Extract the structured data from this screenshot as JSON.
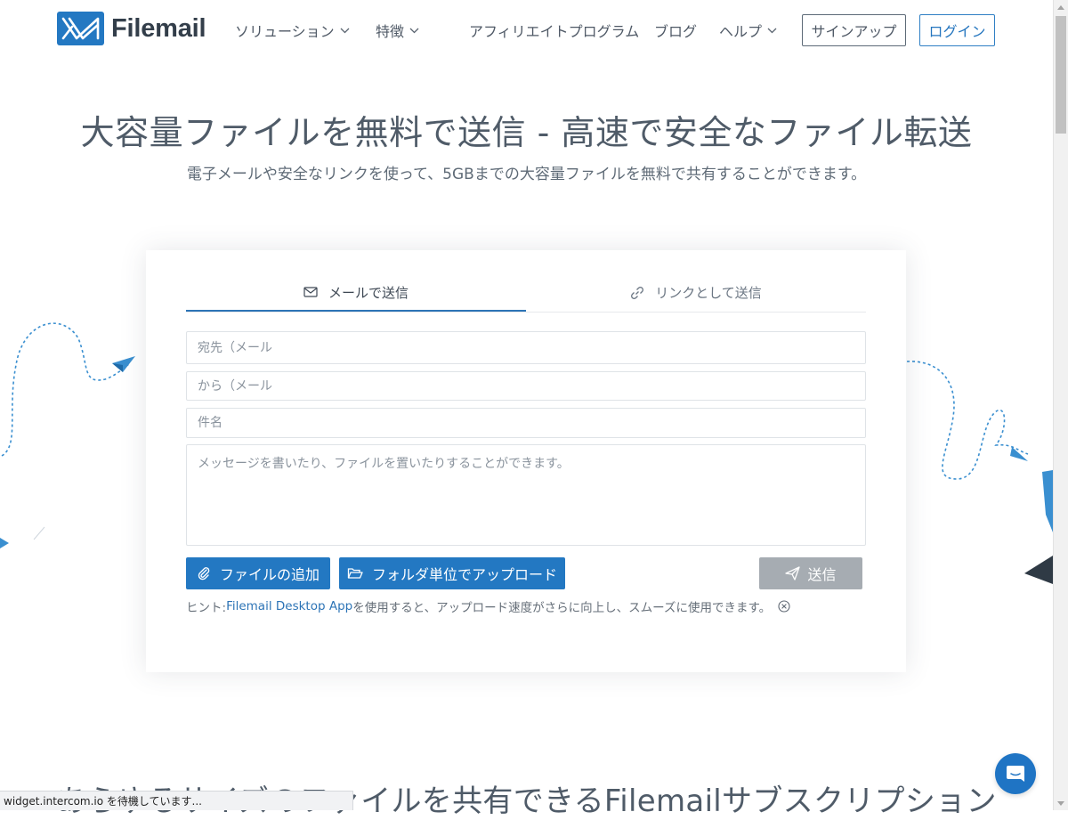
{
  "brand": {
    "name": "Filemail",
    "color": "#2378c2"
  },
  "nav": {
    "solutions": "ソリューション",
    "features": "特徴",
    "affiliate": "アフィリエイトプログラム",
    "blog": "ブログ",
    "help": "ヘルプ",
    "signup": "サインアップ",
    "login": "ログイン"
  },
  "hero": {
    "title": "大容量ファイルを無料で送信 - 高速で安全なファイル転送",
    "subtitle": "電子メールや安全なリンクを使って、5GBまでの大容量ファイルを無料で共有することができます。"
  },
  "form": {
    "tabs": {
      "email": "メールで送信",
      "link": "リンクとして送信"
    },
    "to_placeholder": "宛先（メール",
    "from_placeholder": "から（メール",
    "subject_placeholder": "件名",
    "message_placeholder": "メッセージを書いたり、ファイルを置いたりすることができます。",
    "add_files": "ファイルの追加",
    "upload_folder": "フォルダ単位でアップロード",
    "send": "送信",
    "hint_prefix": "ヒント: ",
    "hint_link": "Filemail Desktop App",
    "hint_suffix": "を使用すると、アップロード速度がさらに向上し、スムーズに使用できます。"
  },
  "bottom": {
    "title": "あらゆるサイズのファイルを共有できるFilemailサブスクリプション"
  },
  "status_bar": "widget.intercom.io を待機しています..."
}
